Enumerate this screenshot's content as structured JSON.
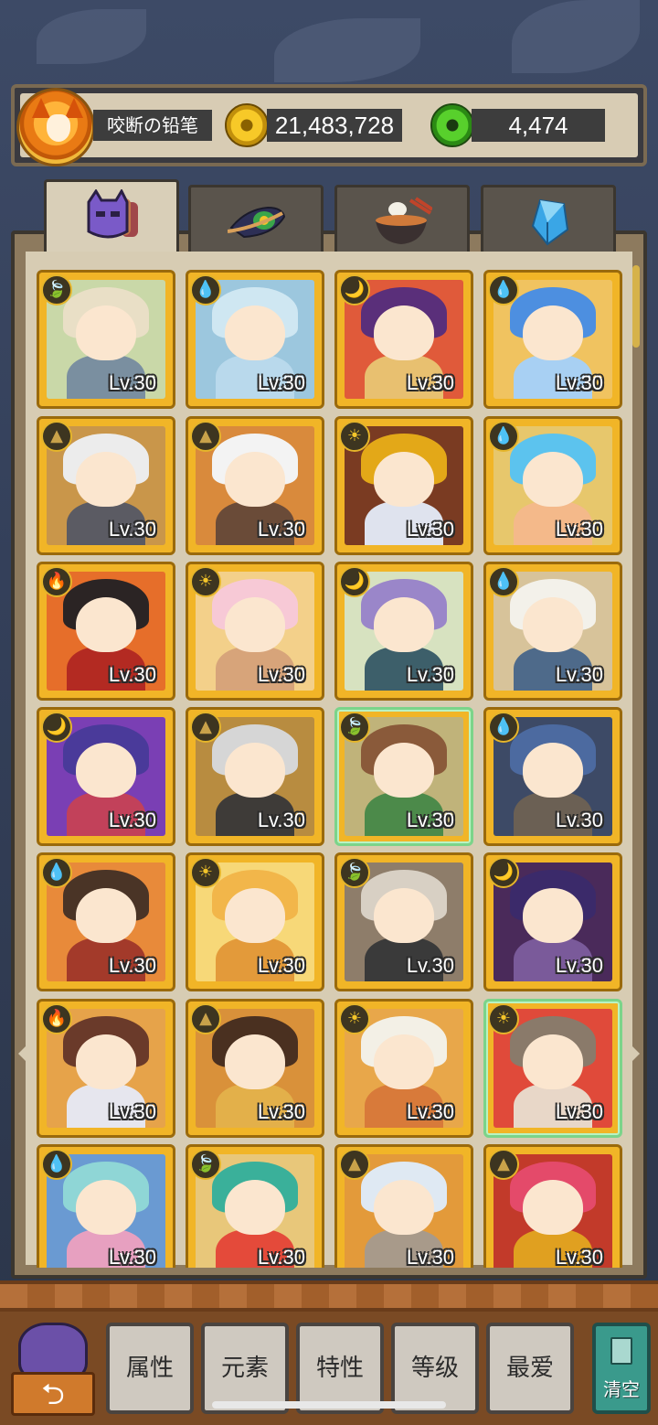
{
  "player": {
    "name": "咬断の铅笔"
  },
  "currency": {
    "gold": "21,483,728",
    "gems": "4,474"
  },
  "tabs": [
    {
      "name": "heroes",
      "icon": "purple-monster-icon",
      "active": true
    },
    {
      "name": "artifacts",
      "icon": "feather-icon",
      "active": false
    },
    {
      "name": "food",
      "icon": "ramen-bowl-icon",
      "active": false
    },
    {
      "name": "crystals",
      "icon": "blue-crystal-icon",
      "active": false
    }
  ],
  "heroes": [
    {
      "level": "Lv.30",
      "element": "earth",
      "hair": "#e9dfc6",
      "body": "#7a8fa0",
      "bg": "#c9d8a8"
    },
    {
      "level": "Lv.30",
      "element": "water",
      "hair": "#cfe7f2",
      "body": "#b9d9ec",
      "bg": "#9cc7de"
    },
    {
      "level": "Lv.30",
      "element": "dark",
      "hair": "#5a2f7a",
      "body": "#e8c070",
      "bg": "#e05a3a"
    },
    {
      "level": "Lv.30",
      "element": "water",
      "hair": "#4d8fe0",
      "body": "#a8d0f3",
      "bg": "#f0c360"
    },
    {
      "level": "Lv.30",
      "element": "light-earth",
      "hair": "#ececec",
      "body": "#5b5b63",
      "bg": "#c9964a"
    },
    {
      "level": "Lv.30",
      "element": "light-earth",
      "hair": "#f3f3f3",
      "body": "#6a4b38",
      "bg": "#d98a3c"
    },
    {
      "level": "Lv.30",
      "element": "light",
      "hair": "#e3a818",
      "body": "#dfe3ee",
      "bg": "#7a3b22"
    },
    {
      "level": "Lv.30",
      "element": "water",
      "hair": "#5cc3ee",
      "body": "#f4b98a",
      "bg": "#e7c76c"
    },
    {
      "level": "Lv.30",
      "element": "fire",
      "hair": "#2b2424",
      "body": "#b32a22",
      "bg": "#e66e2a"
    },
    {
      "level": "Lv.30",
      "element": "light",
      "hair": "#f7c9d6",
      "body": "#d7a47a",
      "bg": "#f3d08a"
    },
    {
      "level": "Lv.30",
      "element": "dark",
      "hair": "#9a86c9",
      "body": "#3d5f6a",
      "bg": "#d7e2c0"
    },
    {
      "level": "Lv.30",
      "element": "water",
      "hair": "#f3f1ea",
      "body": "#4e6a8a",
      "bg": "#d7c39a"
    },
    {
      "level": "Lv.30",
      "element": "dark",
      "hair": "#4a3a9a",
      "body": "#c2415a",
      "bg": "#7a3fb4"
    },
    {
      "level": "Lv.30",
      "element": "light-earth",
      "hair": "#d6d6d6",
      "body": "#3e3b38",
      "bg": "#b88c40"
    },
    {
      "level": "Lv.30",
      "element": "earth",
      "hair": "#8a5a3a",
      "body": "#4c8a4a",
      "bg": "#c0b37a"
    },
    {
      "level": "Lv.30",
      "element": "water",
      "hair": "#4c6aa0",
      "body": "#6b6054",
      "bg": "#3d4a66"
    },
    {
      "level": "Lv.30",
      "element": "water",
      "hair": "#4a3426",
      "body": "#a33a2a",
      "bg": "#e88a3a"
    },
    {
      "level": "Lv.30",
      "element": "light",
      "hair": "#f2b64a",
      "body": "#e39a3a",
      "bg": "#f7d878"
    },
    {
      "level": "Lv.30",
      "element": "earth",
      "hair": "#d8d0c4",
      "body": "#3a3a3a",
      "bg": "#8e7d6a"
    },
    {
      "level": "Lv.30",
      "element": "dark",
      "hair": "#3b2a6a",
      "body": "#7a5a9a",
      "bg": "#4a2a5a"
    },
    {
      "level": "Lv.30",
      "element": "fire",
      "hair": "#6a3a2a",
      "body": "#e6e6ee",
      "bg": "#e6a34a"
    },
    {
      "level": "Lv.30",
      "element": "light-earth",
      "hair": "#4a3020",
      "body": "#e3b04a",
      "bg": "#d9913a"
    },
    {
      "level": "Lv.30",
      "element": "light",
      "hair": "#f3f0e6",
      "body": "#d87a3a",
      "bg": "#e8a74a"
    },
    {
      "level": "Lv.30",
      "element": "light",
      "hair": "#8a7a6a",
      "body": "#e8d7c8",
      "bg": "#e04a3a"
    },
    {
      "level": "Lv.30",
      "element": "water",
      "hair": "#8fd6d6",
      "body": "#e7a0c0",
      "bg": "#6a9ad2"
    },
    {
      "level": "Lv.30",
      "element": "earth",
      "hair": "#3ab09a",
      "body": "#e44a3a",
      "bg": "#e8c77a"
    },
    {
      "level": "Lv.30",
      "element": "light-earth",
      "hair": "#dfe9f3",
      "body": "#a89a8a",
      "bg": "#e39a3a"
    },
    {
      "level": "Lv.30",
      "element": "light-earth",
      "hair": "#e44a6a",
      "body": "#e0a020",
      "bg": "#c23a2a"
    }
  ],
  "filters": [
    {
      "label": "属性"
    },
    {
      "label": "元素"
    },
    {
      "label": "特性"
    },
    {
      "label": "等级"
    },
    {
      "label": "最爱"
    }
  ],
  "clear_label": "清空",
  "back_icon": "back-arrow-icon",
  "element_glyphs": {
    "earth": "🍃",
    "water": "💧",
    "dark": "🌙",
    "light": "☀",
    "light-earth": "▲",
    "fire": "🔥"
  },
  "element_colors": {
    "earth": "#6ab23a",
    "water": "#3aa6e6",
    "dark": "#7a4ac0",
    "light": "#f3c52a",
    "light-earth": "#c9a24a",
    "fire": "#e8541e"
  }
}
